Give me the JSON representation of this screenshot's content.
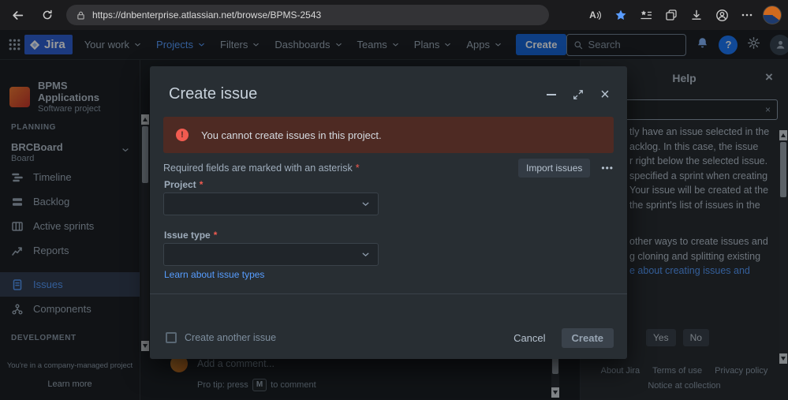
{
  "browser": {
    "url": "https://dnbenterprise.atlassian.net/browse/BPMS-2543"
  },
  "nav": {
    "logo_text": "Jira",
    "items": [
      {
        "label": "Your work"
      },
      {
        "label": "Projects"
      },
      {
        "label": "Filters"
      },
      {
        "label": "Dashboards"
      },
      {
        "label": "Teams"
      },
      {
        "label": "Plans"
      },
      {
        "label": "Apps"
      }
    ],
    "create_label": "Create",
    "search_placeholder": "Search"
  },
  "sidebar": {
    "project_name": "BPMS Applications",
    "project_type": "Software project",
    "planning_label": "PLANNING",
    "board_name": "BRCBoard",
    "board_type": "Board",
    "items": [
      {
        "label": "Timeline"
      },
      {
        "label": "Backlog"
      },
      {
        "label": "Active sprints"
      },
      {
        "label": "Reports"
      },
      {
        "label": "Issues"
      },
      {
        "label": "Components"
      }
    ],
    "development_label": "DEVELOPMENT",
    "footer_note": "You're in a company-managed project",
    "footer_link": "Learn more"
  },
  "main": {
    "comment_placeholder": "Add a comment...",
    "protip_prefix": "Pro tip: press",
    "protip_key": "M",
    "protip_suffix": "to comment"
  },
  "modal": {
    "title": "Create issue",
    "error_message": "You cannot create issues in this project.",
    "required_note": "Required fields are marked with an asterisk",
    "asterisk": "*",
    "import_button": "Import issues",
    "more_button": "•••",
    "project_label": "Project",
    "issue_type_label": "Issue type",
    "learn_link": "Learn about issue types",
    "checkbox_label": "Create another issue",
    "cancel_label": "Cancel",
    "create_label": "Create"
  },
  "help": {
    "title": "Help",
    "paragraph1": [
      "tly have an issue selected in the",
      "acklog. In this case, the issue",
      "r right below the selected issue.",
      "specified a sprint when creating",
      "Your issue will be created at the",
      "the sprint's list of issues in the"
    ],
    "paragraph2": [
      "other ways to create issues and",
      "g cloning and splitting existing",
      "e about creating issues and"
    ],
    "yes_label": "Yes",
    "no_label": "No",
    "footer_links": [
      "About Jira",
      "Terms of use",
      "Privacy policy",
      "Notice at collection"
    ]
  },
  "colors": {
    "accent_blue": "#579dff",
    "error_red": "#f15b50",
    "banner_bg": "#4e2a23"
  }
}
